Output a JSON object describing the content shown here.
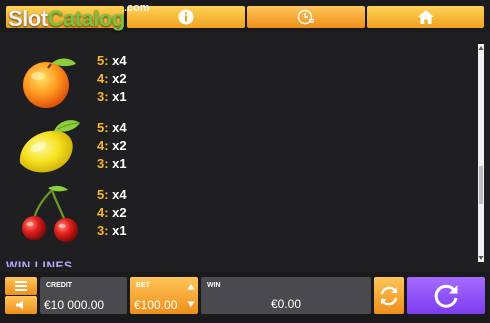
{
  "watermark": {
    "slot": "Slot",
    "catalog": "Catalog",
    "com": ".com"
  },
  "nav": {
    "tabs": [
      {
        "icon": "menu-tab-icon"
      },
      {
        "icon": "info-icon"
      },
      {
        "icon": "history-clock-icon"
      },
      {
        "icon": "home-icon"
      }
    ]
  },
  "paytable": {
    "symbols": [
      {
        "name": "orange",
        "payouts": [
          {
            "count": "5:",
            "mult": " x4"
          },
          {
            "count": "4:",
            "mult": " x2"
          },
          {
            "count": "3:",
            "mult": " x1"
          }
        ]
      },
      {
        "name": "lemon",
        "payouts": [
          {
            "count": "5:",
            "mult": " x4"
          },
          {
            "count": "4:",
            "mult": " x2"
          },
          {
            "count": "3:",
            "mult": " x1"
          }
        ]
      },
      {
        "name": "cherry",
        "payouts": [
          {
            "count": "5:",
            "mult": " x4"
          },
          {
            "count": "4:",
            "mult": " x2"
          },
          {
            "count": "3:",
            "mult": " x1"
          }
        ]
      }
    ],
    "next_section_title": "WIN LINES"
  },
  "footer": {
    "credit_label": "CREDIT",
    "credit_value": "€10 000.00",
    "bet_label": "BET",
    "bet_value": "€100.00",
    "win_label": "WIN",
    "win_value": "€0.00"
  },
  "colors": {
    "accent_orange": "#f5a623",
    "spin_purple": "#8a4dff",
    "payout_count": "#f5b82e",
    "background": "#1f1f22"
  }
}
